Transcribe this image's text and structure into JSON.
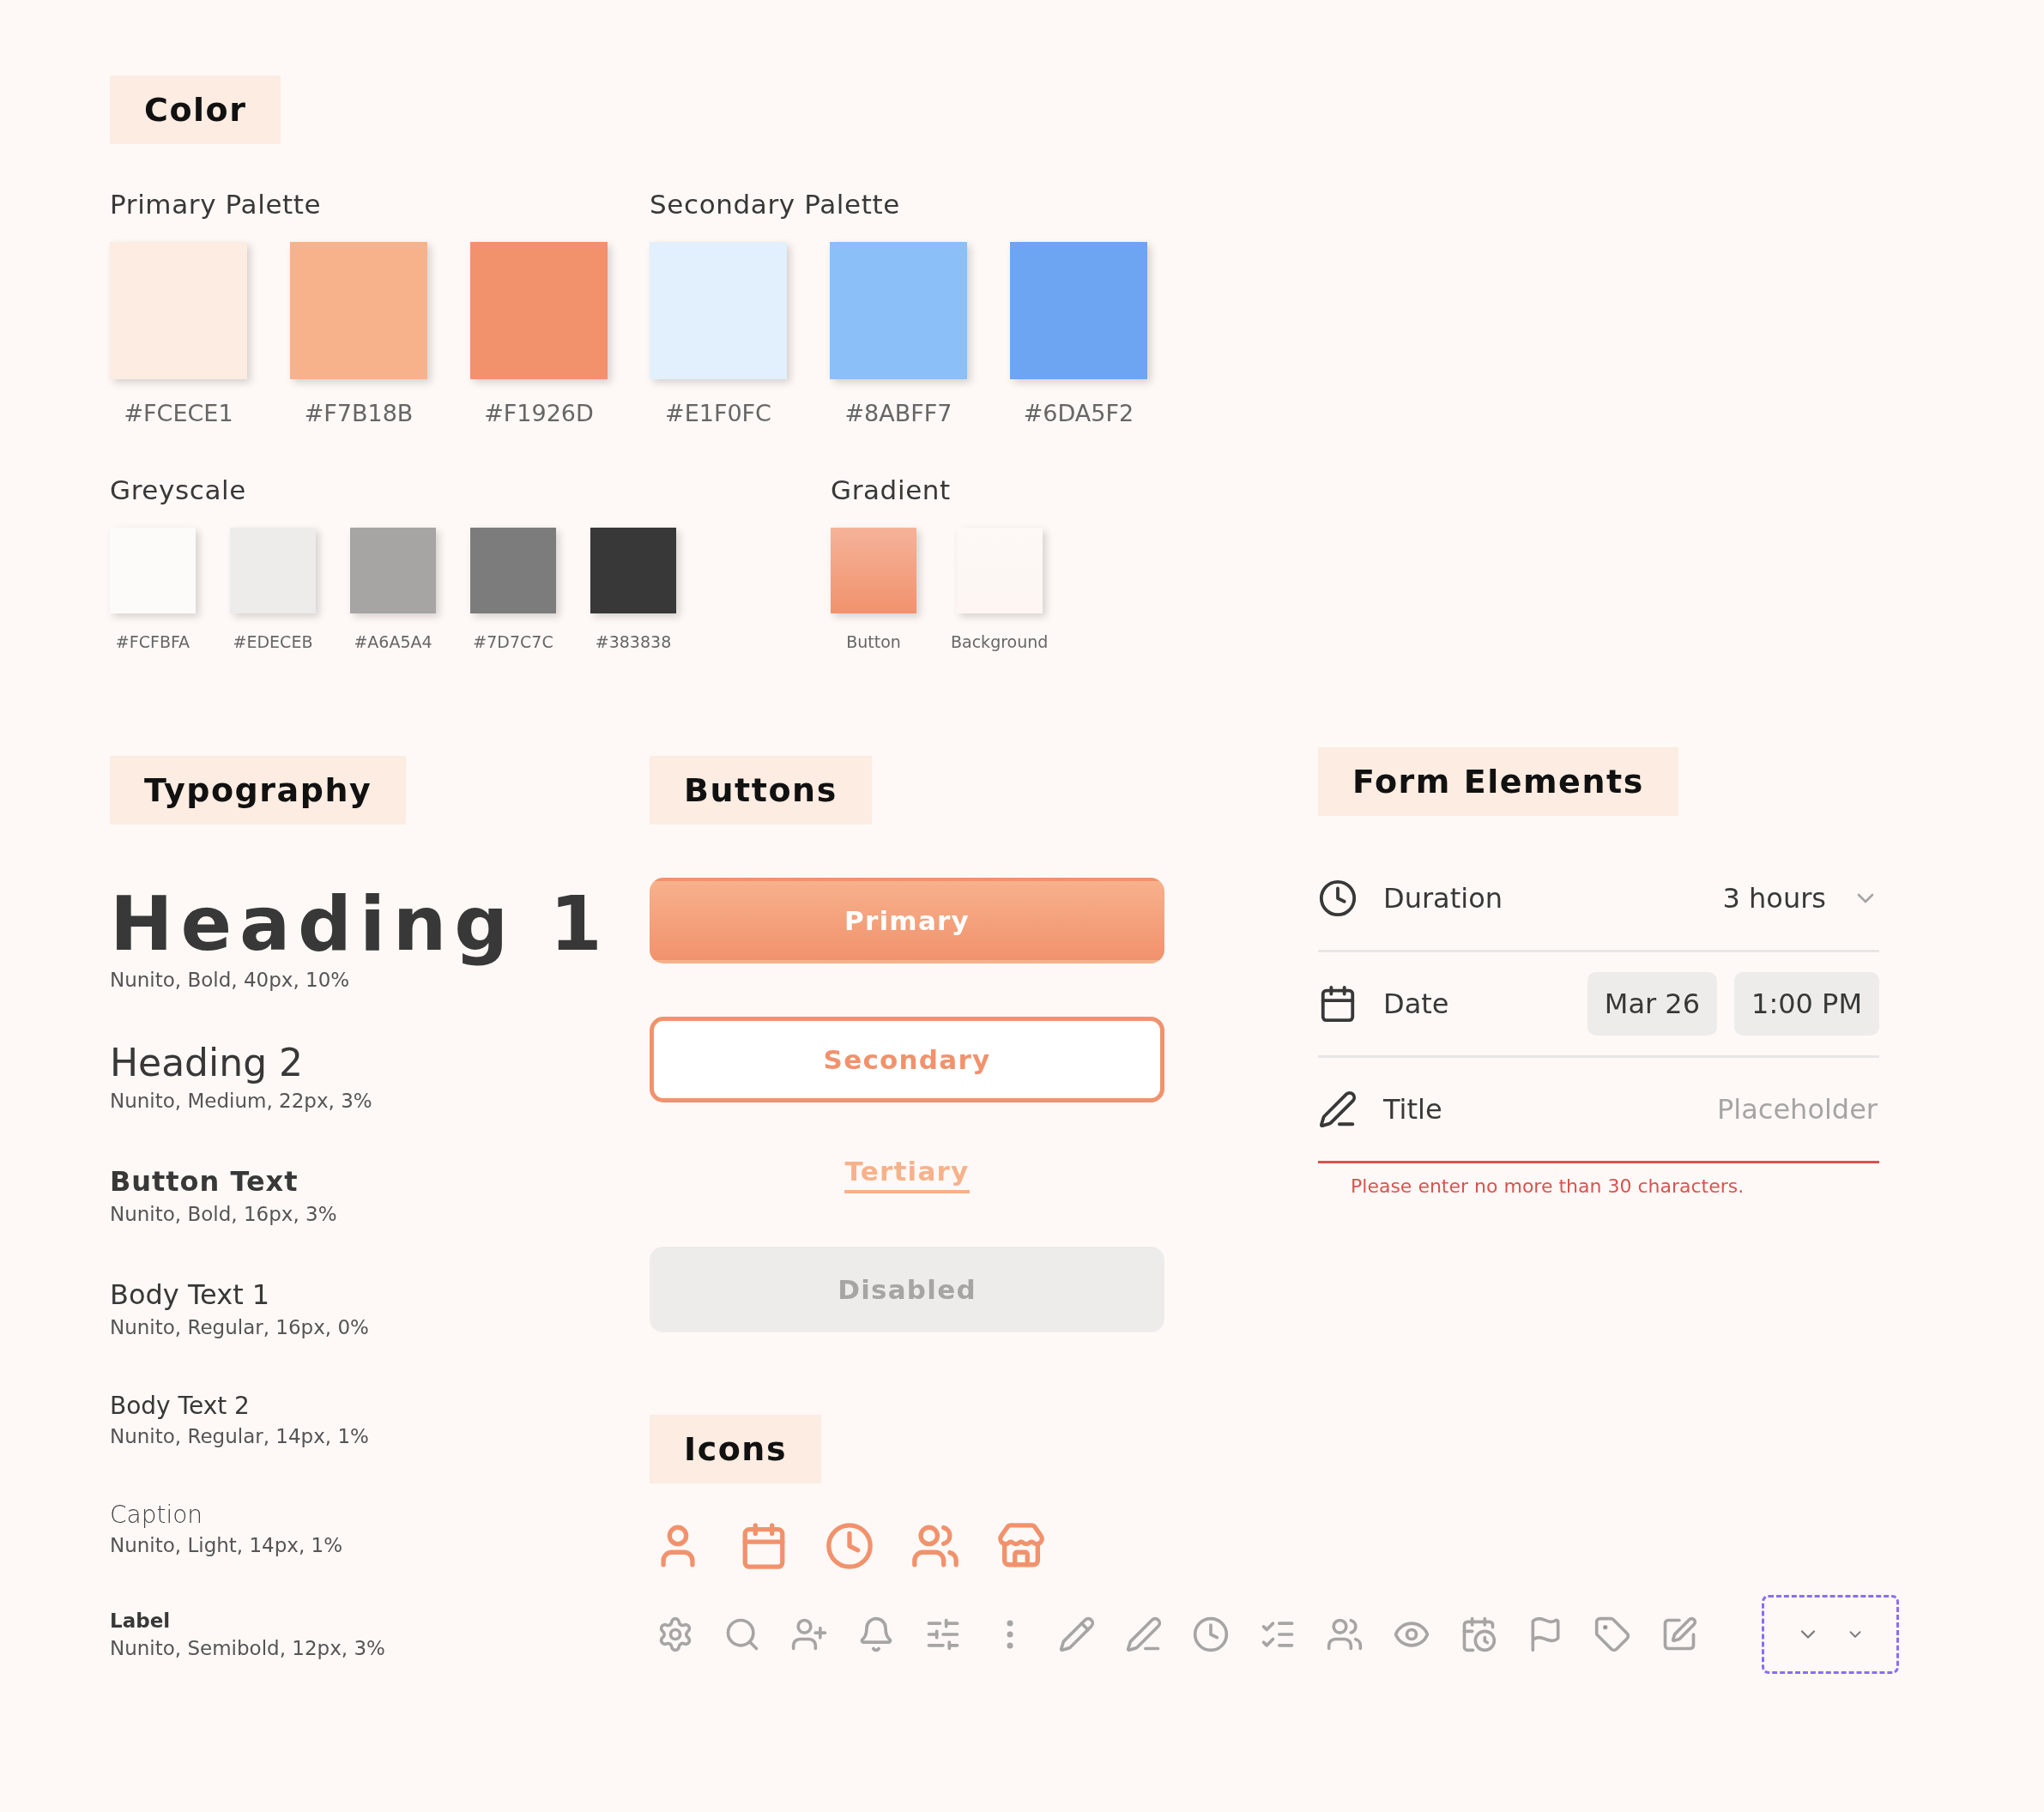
{
  "color_section": {
    "title": "Color",
    "primary_palette": {
      "title": "Primary Palette",
      "swatches": [
        {
          "label": "#FCECE1",
          "color": "#fcece1"
        },
        {
          "label": "#F7B18B",
          "color": "#f7b18b"
        },
        {
          "label": "#F1926D",
          "color": "#f1926d"
        }
      ]
    },
    "secondary_palette": {
      "title": "Secondary Palette",
      "swatches": [
        {
          "label": "#E1F0FC",
          "color": "#e1f0fc"
        },
        {
          "label": "#8ABFF7",
          "color": "#8abff7"
        },
        {
          "label": "#6DA5F2",
          "color": "#6da5f2"
        }
      ]
    },
    "greyscale": {
      "title": "Greyscale",
      "swatches": [
        {
          "label": "#FCFBFA",
          "color": "#fcfbfa"
        },
        {
          "label": "#EDECEB",
          "color": "#edeceb"
        },
        {
          "label": "#A6A5A4",
          "color": "#a6a5a4"
        },
        {
          "label": "#7D7C7C",
          "color": "#7d7c7c"
        },
        {
          "label": "#383838",
          "color": "#383838"
        }
      ]
    },
    "gradient": {
      "title": "Gradient",
      "swatches": [
        {
          "label": "Button",
          "color": "#f1926d"
        },
        {
          "label": "Background",
          "color": "#fdf6f2"
        }
      ]
    }
  },
  "typography": {
    "title": "Typography",
    "samples": [
      {
        "kind": "h1",
        "sample": "Heading 1",
        "spec": "Nunito, Bold, 40px, 10%"
      },
      {
        "kind": "h2",
        "sample": "Heading 2",
        "spec": "Nunito, Medium, 22px, 3%"
      },
      {
        "kind": "button",
        "sample": "Button Text",
        "spec": "Nunito, Bold, 16px, 3%"
      },
      {
        "kind": "body1",
        "sample": "Body Text 1",
        "spec": "Nunito, Regular, 16px, 0%"
      },
      {
        "kind": "body2",
        "sample": "Body Text 2",
        "spec": "Nunito, Regular, 14px, 1%"
      },
      {
        "kind": "caption",
        "sample": "Caption",
        "spec": "Nunito, Light, 14px, 1%"
      },
      {
        "kind": "label",
        "sample": "Label",
        "spec": "Nunito, Semibold, 12px, 3%"
      }
    ]
  },
  "buttons": {
    "title": "Buttons",
    "items": [
      {
        "kind": "primary",
        "label": "Primary",
        "disabled": false
      },
      {
        "kind": "secondary",
        "label": "Secondary",
        "disabled": false
      },
      {
        "kind": "tertiary",
        "label": "Tertiary",
        "disabled": false
      },
      {
        "kind": "primary",
        "label": "Disabled",
        "disabled": true
      }
    ]
  },
  "icons": {
    "title": "Icons"
  },
  "form_elements": {
    "title": "Form Elements",
    "rows": [
      {
        "kind": "select",
        "label": "Duration",
        "value": "3 hours"
      },
      {
        "kind": "datetime",
        "label": "Date",
        "date": "Mar 26",
        "time": "1:00 PM"
      },
      {
        "kind": "text",
        "label": "Title",
        "placeholder": "Placeholder",
        "invalid": true,
        "error": "Please enter no more than 30 characters."
      }
    ]
  }
}
